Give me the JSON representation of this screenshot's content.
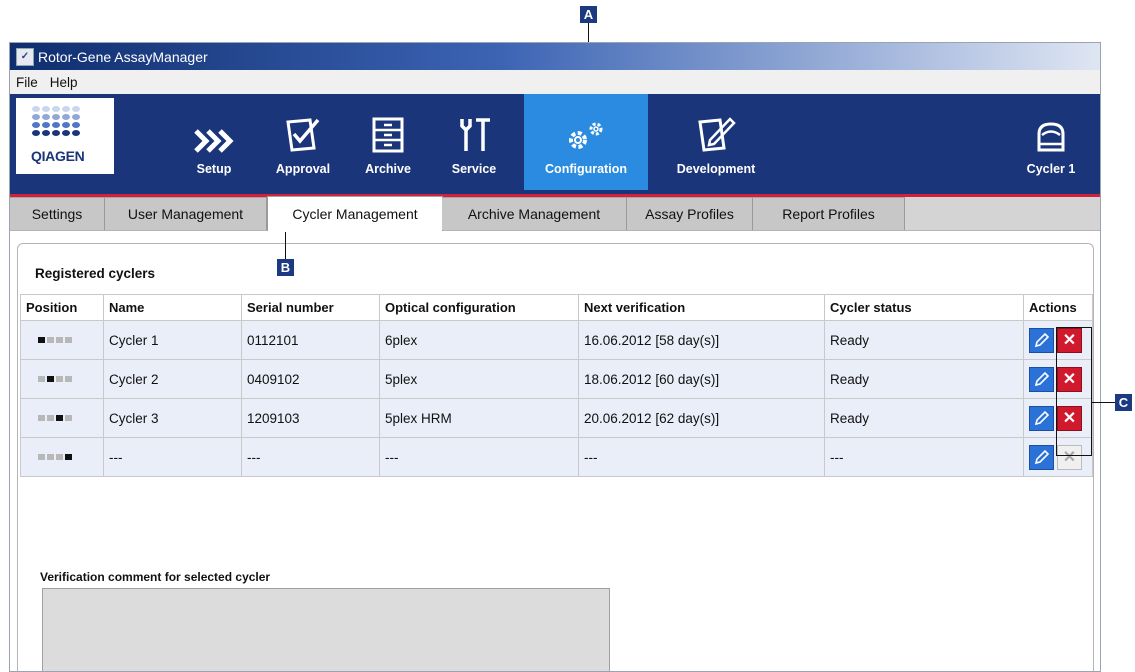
{
  "window": {
    "title": "Rotor-Gene AssayManager"
  },
  "menu": {
    "items": [
      "File",
      "Help"
    ]
  },
  "logo": {
    "text": "QIAGEN"
  },
  "nav": {
    "items": [
      {
        "label": "Setup",
        "icon": "chevron-double-right-icon"
      },
      {
        "label": "Approval",
        "icon": "checkmark-document-icon"
      },
      {
        "label": "Archive",
        "icon": "archive-cabinet-icon"
      },
      {
        "label": "Service",
        "icon": "tools-icon"
      },
      {
        "label": "Configuration",
        "icon": "gears-icon",
        "active": true
      },
      {
        "label": "Development",
        "icon": "edit-document-icon"
      }
    ],
    "cycler": {
      "label": "Cycler 1",
      "icon": "cycler-icon"
    }
  },
  "tabs": [
    "Settings",
    "User Management",
    "Cycler Management",
    "Archive Management",
    "Assay Profiles",
    "Report Profiles"
  ],
  "active_tab": "Cycler Management",
  "panel": {
    "title": "Registered cyclers",
    "columns": [
      "Position",
      "Name",
      "Serial number",
      "Optical configuration",
      "Next verification",
      "Cycler status",
      "Actions"
    ],
    "rows": [
      {
        "position": 1,
        "name": "Cycler 1",
        "serial": "0112101",
        "optical": "6plex",
        "next": "16.06.2012 [58 day(s)]",
        "status": "Ready",
        "delete_enabled": true
      },
      {
        "position": 2,
        "name": "Cycler 2",
        "serial": "0409102",
        "optical": "5plex",
        "next": "18.06.2012 [60 day(s)]",
        "status": "Ready",
        "delete_enabled": true
      },
      {
        "position": 3,
        "name": "Cycler 3",
        "serial": "1209103",
        "optical": "5plex HRM",
        "next": "20.06.2012 [62 day(s)]",
        "status": "Ready",
        "delete_enabled": true
      },
      {
        "position": 4,
        "name": "---",
        "serial": "---",
        "optical": "---",
        "next": "---",
        "status": "---",
        "delete_enabled": false
      }
    ],
    "comment_label": "Verification comment for selected cycler",
    "comment_value": ""
  },
  "callouts": {
    "a": "A",
    "b": "B",
    "c": "C"
  },
  "colors": {
    "nav_bg": "#1a357a",
    "nav_active": "#2a8be0",
    "accent_red": "#d0223a",
    "edit_blue": "#2a72d8",
    "delete_red": "#d0192d"
  }
}
